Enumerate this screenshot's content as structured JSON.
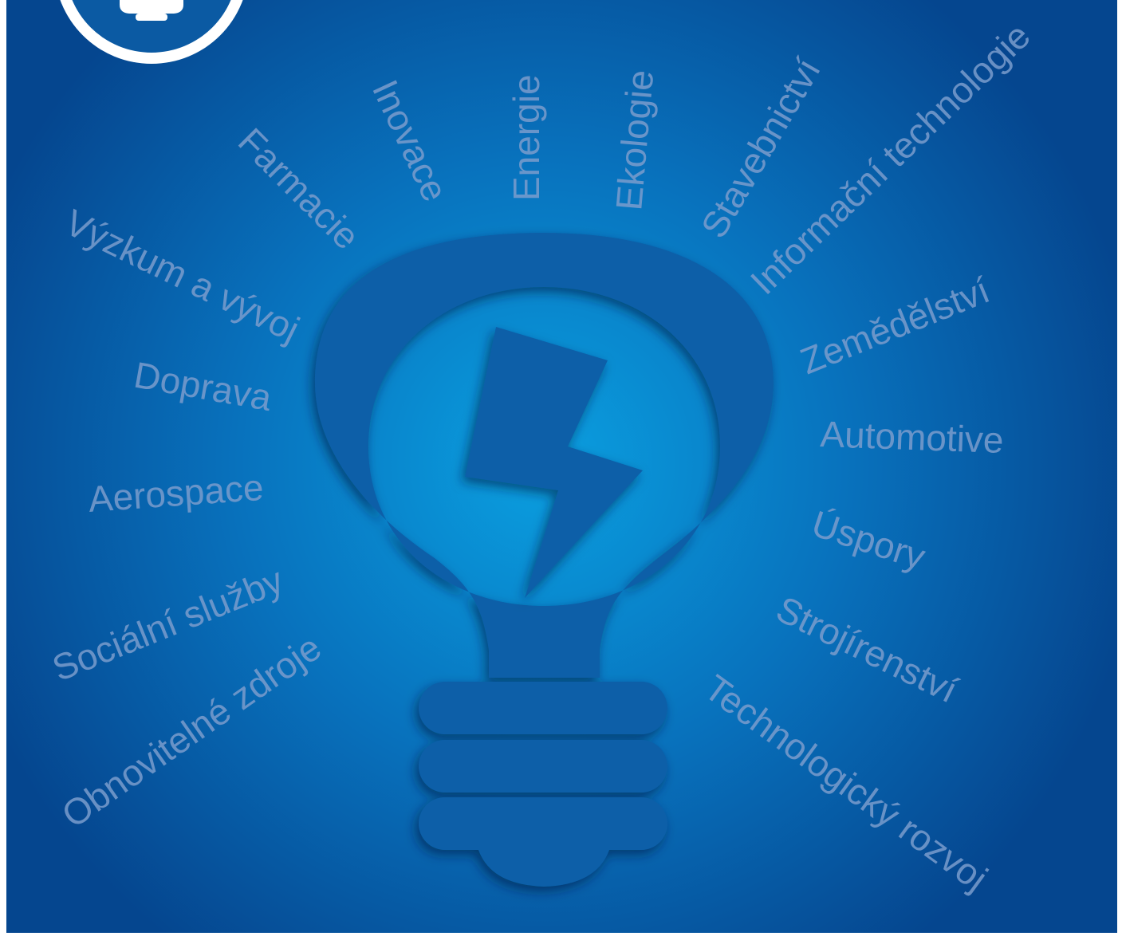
{
  "colors": {
    "background_center": "#0a9fe0",
    "background_mid": "#0872bd",
    "background_edge": "#05468f",
    "bulb": "#0a5fa8",
    "badge": "#0b5aa3",
    "frame": "#ffffff",
    "word": "#7a9ccc"
  },
  "icons": {
    "bulb": "light-bulb-icon",
    "bolt": "lightning-bolt-icon",
    "badge": "bulb-badge-icon"
  },
  "keywords": [
    "Inovace",
    "Energie",
    "Ekologie",
    "Farmacie",
    "Stavebnictví",
    "Informační technologie",
    "Výzkum a vývoj",
    "Zemědělství",
    "Doprava",
    "Automotive",
    "Aerospace",
    "Úspory",
    "Sociální služby",
    "Strojírenství",
    "Obnovitelné zdroje",
    "Technologický rozvoj"
  ]
}
